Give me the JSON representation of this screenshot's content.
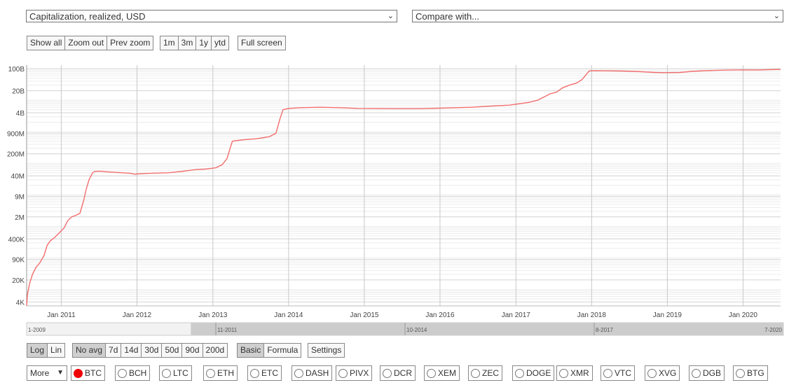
{
  "selectors": {
    "metric": "Capitalization, realized, USD",
    "compare": "Compare with..."
  },
  "zoom_buttons": [
    "Show all",
    "Zoom out",
    "Prev zoom"
  ],
  "range_buttons": [
    "1m",
    "3m",
    "1y",
    "ytd"
  ],
  "fullscreen_label": "Full screen",
  "scale_buttons": [
    "Log",
    "Lin"
  ],
  "scale_active": "Log",
  "avg_buttons": [
    "No avg",
    "7d",
    "14d",
    "30d",
    "50d",
    "90d",
    "200d"
  ],
  "avg_active": "No avg",
  "mode_buttons": [
    "Basic",
    "Formula"
  ],
  "mode_active": "Basic",
  "settings_label": "Settings",
  "more_label": "More",
  "coins": [
    {
      "label": "BTC",
      "selected": true
    },
    {
      "label": "BCH",
      "selected": false
    },
    {
      "label": "LTC",
      "selected": false
    },
    {
      "label": "ETH",
      "selected": false
    },
    {
      "label": "ETC",
      "selected": false
    },
    {
      "label": "DASH",
      "selected": false
    },
    {
      "label": "PIVX",
      "selected": false
    },
    {
      "label": "DCR",
      "selected": false
    },
    {
      "label": "XEM",
      "selected": false
    },
    {
      "label": "ZEC",
      "selected": false
    },
    {
      "label": "DOGE",
      "selected": false
    },
    {
      "label": "XMR",
      "selected": false
    },
    {
      "label": "VTC",
      "selected": false
    },
    {
      "label": "XVG",
      "selected": false
    },
    {
      "label": "DGB",
      "selected": false
    },
    {
      "label": "BTG",
      "selected": false
    }
  ],
  "colors": {
    "line": "#f26d6d",
    "navigator_fill": "#cccccc",
    "selected_radio": "#e00000"
  },
  "chart_data": {
    "type": "line",
    "y_scale": "log",
    "ylim": [
      3000,
      130000000000
    ],
    "xlim": [
      "2010-07-18",
      "2020-06-30"
    ],
    "ytick_labels": [
      "4K",
      "20K",
      "90K",
      "400K",
      "2M",
      "9M",
      "40M",
      "200M",
      "900M",
      "4B",
      "20B",
      "100B"
    ],
    "ytick_values": [
      4000,
      20000,
      90000,
      400000,
      2000000,
      9000000,
      40000000,
      200000000,
      900000000,
      4000000000,
      20000000000,
      100000000000
    ],
    "xtick_labels": [
      "Jan 2011",
      "Jan 2012",
      "Jan 2013",
      "Jan 2014",
      "Jan 2015",
      "Jan 2016",
      "Jan 2017",
      "Jan 2018",
      "Jan 2019",
      "Jan 2020"
    ],
    "xtick_values": [
      "2011-01-01",
      "2012-01-01",
      "2013-01-01",
      "2014-01-01",
      "2015-01-01",
      "2016-01-01",
      "2017-01-01",
      "2018-01-01",
      "2019-01-01",
      "2020-01-01"
    ],
    "grid": true,
    "legend": "none",
    "series": [
      {
        "x": [
          "2010-07-18",
          "2010-07-22",
          "2010-08-01",
          "2010-08-15",
          "2010-09-01",
          "2010-09-20",
          "2010-10-10",
          "2010-10-25",
          "2010-11-10",
          "2010-12-01",
          "2010-12-20",
          "2011-01-15",
          "2011-02-01",
          "2011-02-20",
          "2011-03-10",
          "2011-04-01",
          "2011-04-20",
          "2011-05-01",
          "2011-05-15",
          "2011-06-01",
          "2011-06-10",
          "2011-07-01",
          "2011-08-01",
          "2011-10-01",
          "2011-12-01",
          "2011-12-20",
          "2012-01-01",
          "2012-03-01",
          "2012-06-01",
          "2012-08-01",
          "2012-10-01",
          "2012-12-01",
          "2013-01-15",
          "2013-02-15",
          "2013-03-10",
          "2013-03-25",
          "2013-04-05",
          "2013-04-20",
          "2013-06-01",
          "2013-08-01",
          "2013-10-01",
          "2013-11-01",
          "2013-11-20",
          "2013-12-05",
          "2013-12-31",
          "2014-03-01",
          "2014-06-01",
          "2014-09-01",
          "2014-12-01",
          "2015-06-01",
          "2015-10-01",
          "2016-01-01",
          "2016-06-01",
          "2016-09-01",
          "2016-12-01",
          "2017-03-01",
          "2017-04-15",
          "2017-05-20",
          "2017-06-15",
          "2017-07-15",
          "2017-08-15",
          "2017-09-15",
          "2017-10-20",
          "2017-11-15",
          "2017-12-10",
          "2017-12-20",
          "2018-01-15",
          "2018-03-01",
          "2018-06-01",
          "2018-09-01",
          "2018-11-01",
          "2018-12-15",
          "2019-03-01",
          "2019-05-01",
          "2019-07-01",
          "2019-10-01",
          "2020-01-01",
          "2020-03-15",
          "2020-05-01",
          "2020-06-30"
        ],
        "y": [
          3000,
          7000,
          15000,
          30000,
          50000,
          70000,
          120000,
          250000,
          350000,
          450000,
          600000,
          900000,
          1500000,
          2000000,
          2200000,
          2600000,
          7000000,
          15000000,
          30000000,
          50000000,
          55000000,
          56000000,
          54000000,
          51000000,
          48000000,
          45000000,
          46000000,
          48000000,
          50000000,
          55000000,
          62000000,
          66000000,
          72000000,
          90000000,
          140000000,
          300000000,
          500000000,
          520000000,
          560000000,
          600000000,
          700000000,
          900000000,
          2500000000,
          5000000000,
          5500000000,
          5800000000,
          6000000000,
          5800000000,
          5500000000,
          5400000000,
          5400000000,
          5600000000,
          6000000000,
          6500000000,
          7000000000,
          8500000000,
          10000000000,
          13000000000,
          16000000000,
          18000000000,
          25000000000,
          30000000000,
          35000000000,
          45000000000,
          70000000000,
          85000000000,
          87000000000,
          86000000000,
          84000000000,
          80000000000,
          76000000000,
          75000000000,
          76000000000,
          82000000000,
          87000000000,
          90000000000,
          92000000000,
          91000000000,
          93000000000,
          95000000000
        ]
      }
    ],
    "navigator": {
      "labels": [
        "1-2009",
        "11-2011",
        "10-2014",
        "8-2017",
        "7-2020"
      ],
      "range_start": "2011-07-01",
      "range_end": "2020-07-01"
    }
  }
}
